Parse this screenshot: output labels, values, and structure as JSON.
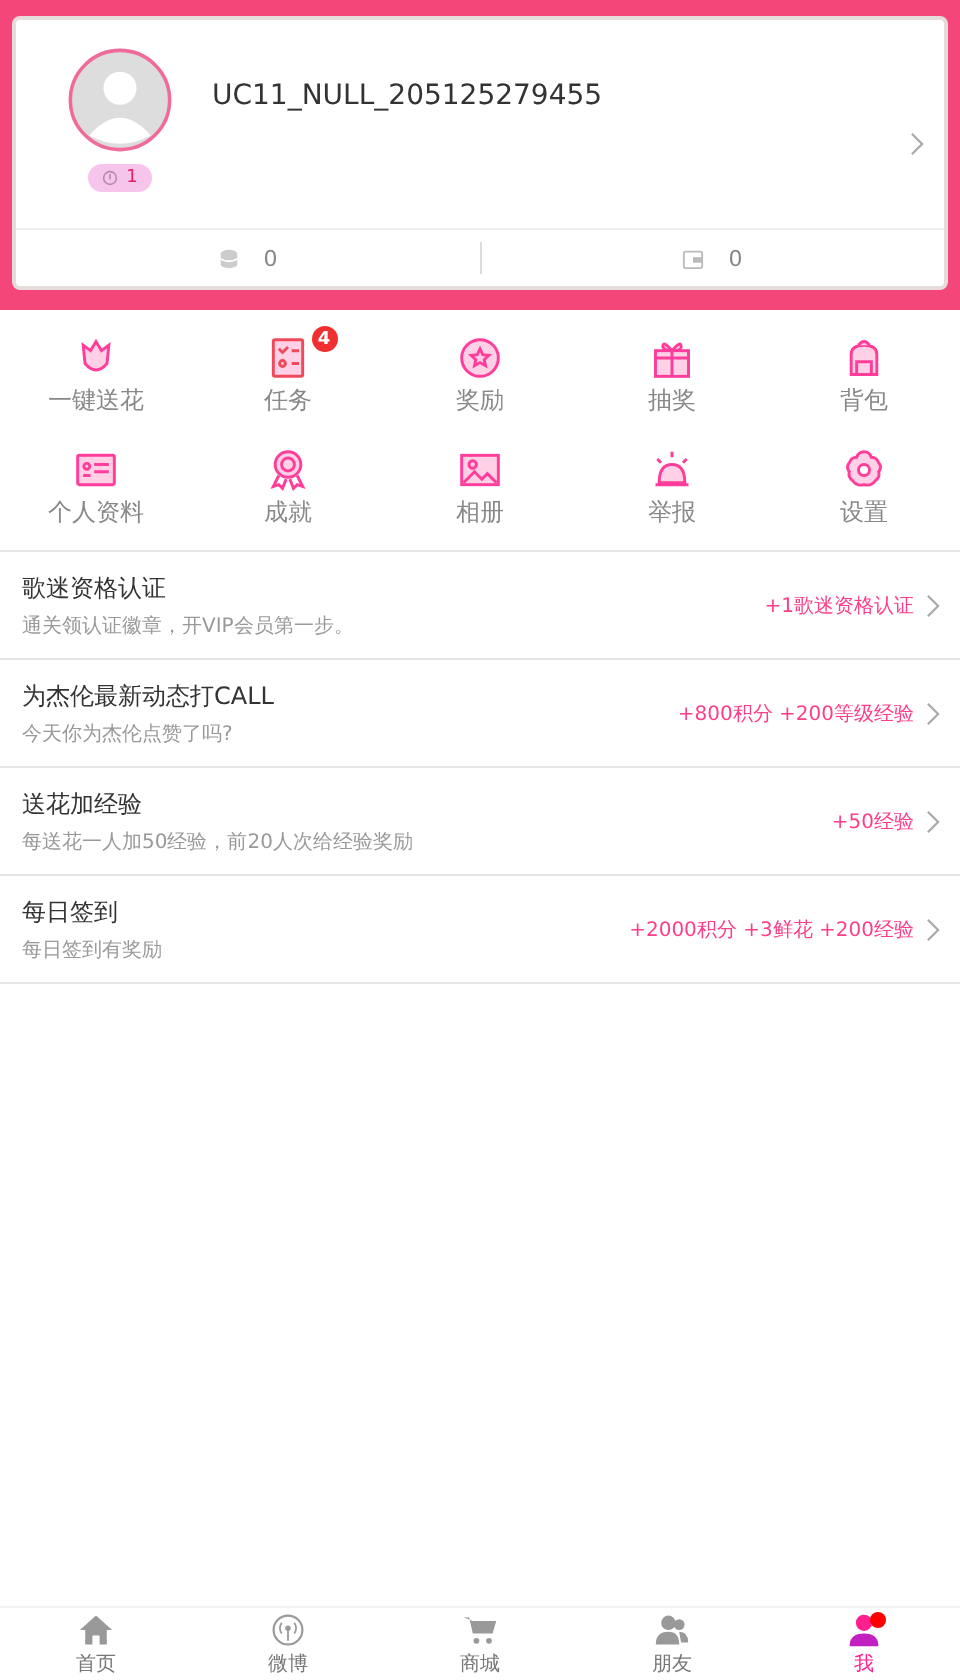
{
  "profile": {
    "username": "UC11_NULL_205125279455",
    "level_badge": "1",
    "stats": [
      {
        "kind": "coins",
        "value": "0"
      },
      {
        "kind": "wallet",
        "value": "0"
      }
    ]
  },
  "shortcuts": [
    {
      "kind": "flower",
      "label": "一键送花"
    },
    {
      "kind": "tasks",
      "label": "任务",
      "badge": "4"
    },
    {
      "kind": "star",
      "label": "奖励"
    },
    {
      "kind": "gift",
      "label": "抽奖"
    },
    {
      "kind": "bag",
      "label": "背包"
    },
    {
      "kind": "card",
      "label": "个人资料"
    },
    {
      "kind": "medal",
      "label": "成就"
    },
    {
      "kind": "image",
      "label": "相册"
    },
    {
      "kind": "alarm",
      "label": "举报"
    },
    {
      "kind": "gear",
      "label": "设置"
    }
  ],
  "tasks": [
    {
      "title": "歌迷资格认证",
      "subtitle": "通关领认证徽章，开VIP会员第一步。",
      "reward": "+1歌迷资格认证"
    },
    {
      "title": "为杰伦最新动态打CALL",
      "subtitle": "今天你为杰伦点赞了吗?",
      "reward": "+800积分 +200等级经验"
    },
    {
      "title": "送花加经验",
      "subtitle": "每送花一人加50经验，前20人次给经验奖励",
      "reward": "+50经验"
    },
    {
      "title": "每日签到",
      "subtitle": "每日签到有奖励",
      "reward": "+2000积分 +3鲜花 +200经验"
    }
  ],
  "tab_bar": [
    {
      "kind": "home",
      "label": "首页",
      "selected": false,
      "dot": false
    },
    {
      "kind": "signal",
      "label": "微博",
      "selected": false,
      "dot": false
    },
    {
      "kind": "cart",
      "label": "商城",
      "selected": false,
      "dot": false
    },
    {
      "kind": "friends",
      "label": "朋友",
      "selected": false,
      "dot": false
    },
    {
      "kind": "me",
      "label": "我",
      "selected": true,
      "dot": true
    }
  ]
}
